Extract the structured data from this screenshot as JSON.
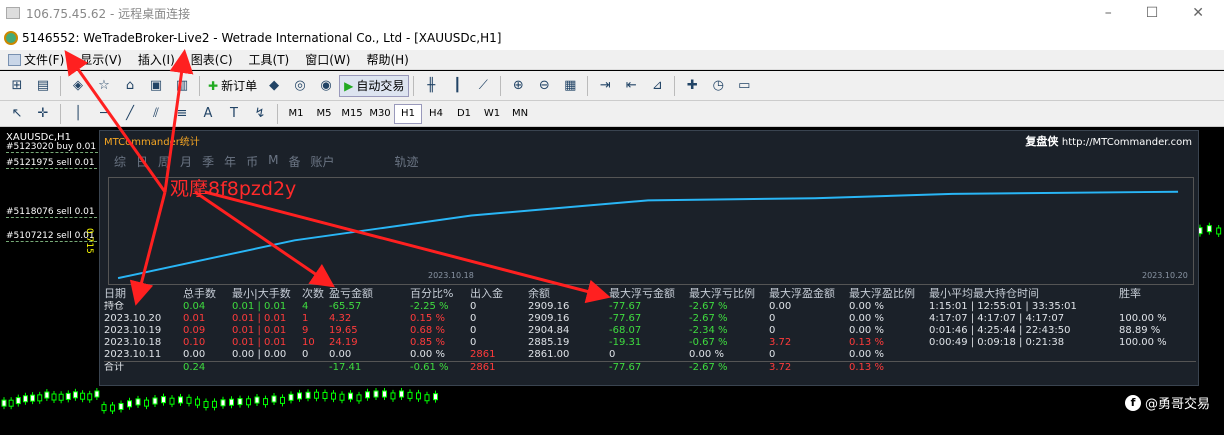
{
  "rdp": {
    "title": "106.75.45.62 - 远程桌面连接"
  },
  "window": {
    "title": "5146552: WeTradeBroker-Live2 - Wetrade International Co., Ltd - [XAUUSDc,H1]"
  },
  "menu": [
    "文件(F)",
    "显示(V)",
    "插入(I)",
    "图表(C)",
    "工具(T)",
    "窗口(W)",
    "帮助(H)"
  ],
  "toolbar": {
    "new_order": "新订单",
    "auto_trading": "自动交易"
  },
  "timeframes": [
    "M1",
    "M5",
    "M15",
    "M30",
    "H1",
    "H4",
    "D1",
    "W1",
    "MN"
  ],
  "active_timeframe": "H1",
  "chart": {
    "symbol": "XAUUSDc,H1",
    "orders": [
      "#5123020 buy 0.01",
      "#5121975 sell 0.01",
      "#5118076 sell 0.01",
      "#5107212 sell 0.01"
    ],
    "side_label": "0.715"
  },
  "mtc": {
    "title": "MTCommander统计",
    "brand": "复盘侠",
    "url": "http://MTCommander.com",
    "tabs": [
      "综",
      "日",
      "周",
      "月",
      "季",
      "年",
      "币",
      "M",
      "备",
      "账户",
      "轨迹"
    ],
    "start_date": "2023.10.18",
    "end_date": "2023.10.20",
    "equity_curve": [
      0,
      0.35,
      0.58,
      0.72,
      0.74,
      0.78,
      0.8
    ],
    "headers": [
      "日期",
      "总手数",
      "最小|大手数",
      "次数",
      "盈亏金额",
      "百分比%",
      "出入金",
      "余额",
      "最大浮亏金额",
      "最大浮亏比例",
      "最大浮盈金额",
      "最大浮盈比例",
      "最小平均最大持仓时间",
      "胜率"
    ],
    "rows": [
      {
        "c": [
          "持仓",
          "0.04",
          "0.01 | 0.01",
          "4",
          "-65.57",
          "-2.25 %",
          "0",
          "2909.16",
          "-77.67",
          "-2.67 %",
          "0.00",
          "0.00 %",
          "1:15:01 | 12:55:01 | 33:35:01",
          ""
        ],
        "k": [
          "w",
          "p",
          "p",
          "p",
          "p",
          "p",
          "w",
          "w",
          "p",
          "p",
          "w",
          "w",
          "w",
          "w"
        ]
      },
      {
        "c": [
          "2023.10.20",
          "0.01",
          "0.01 | 0.01",
          "1",
          "4.32",
          "0.15 %",
          "0",
          "2909.16",
          "-77.67",
          "-2.67 %",
          "0",
          "0.00 %",
          "4:17:07 | 4:17:07 | 4:17:07",
          "100.00 %"
        ],
        "k": [
          "w",
          "n",
          "n",
          "n",
          "n",
          "n",
          "w",
          "w",
          "p",
          "p",
          "w",
          "w",
          "w",
          "w"
        ]
      },
      {
        "c": [
          "2023.10.19",
          "0.09",
          "0.01 | 0.01",
          "9",
          "19.65",
          "0.68 %",
          "0",
          "2904.84",
          "-68.07",
          "-2.34 %",
          "0",
          "0.00 %",
          "0:01:46 | 4:25:44 | 22:43:50",
          "88.89 %"
        ],
        "k": [
          "w",
          "n",
          "n",
          "n",
          "n",
          "n",
          "w",
          "w",
          "p",
          "p",
          "w",
          "w",
          "w",
          "w"
        ]
      },
      {
        "c": [
          "2023.10.18",
          "0.10",
          "0.01 | 0.01",
          "10",
          "24.19",
          "0.85 %",
          "0",
          "2885.19",
          "-19.31",
          "-0.67 %",
          "3.72",
          "0.13 %",
          "0:00:49 | 0:09:18 | 0:21:38",
          "100.00 %"
        ],
        "k": [
          "w",
          "n",
          "n",
          "n",
          "n",
          "n",
          "w",
          "w",
          "p",
          "p",
          "n",
          "n",
          "w",
          "w"
        ]
      },
      {
        "c": [
          "2023.10.11",
          "0.00",
          "0.00 | 0.00",
          "0",
          "0.00",
          "0.00 %",
          "2861",
          "2861.00",
          "0",
          "0.00 %",
          "0",
          "0.00 %",
          "",
          ""
        ],
        "k": [
          "w",
          "w",
          "w",
          "w",
          "w",
          "w",
          "n",
          "w",
          "w",
          "w",
          "w",
          "w",
          "w",
          "w"
        ]
      }
    ],
    "total": {
      "c": [
        "合计",
        "0.24",
        "",
        "",
        "-17.41",
        "-0.61 %",
        "2861",
        "",
        "-77.67",
        "-2.67 %",
        "3.72",
        "0.13 %",
        "",
        ""
      ],
      "k": [
        "w",
        "p",
        "w",
        "w",
        "p",
        "p",
        "n",
        "w",
        "p",
        "p",
        "n",
        "n",
        "w",
        "w"
      ]
    }
  },
  "watermark": "观摩8f8pzd2y",
  "social": "@勇哥交易",
  "colors": {
    "positive": "#3fdc3f",
    "negative": "#ff3b3b",
    "curve": "#29b6f6",
    "title": "#f5a623"
  }
}
